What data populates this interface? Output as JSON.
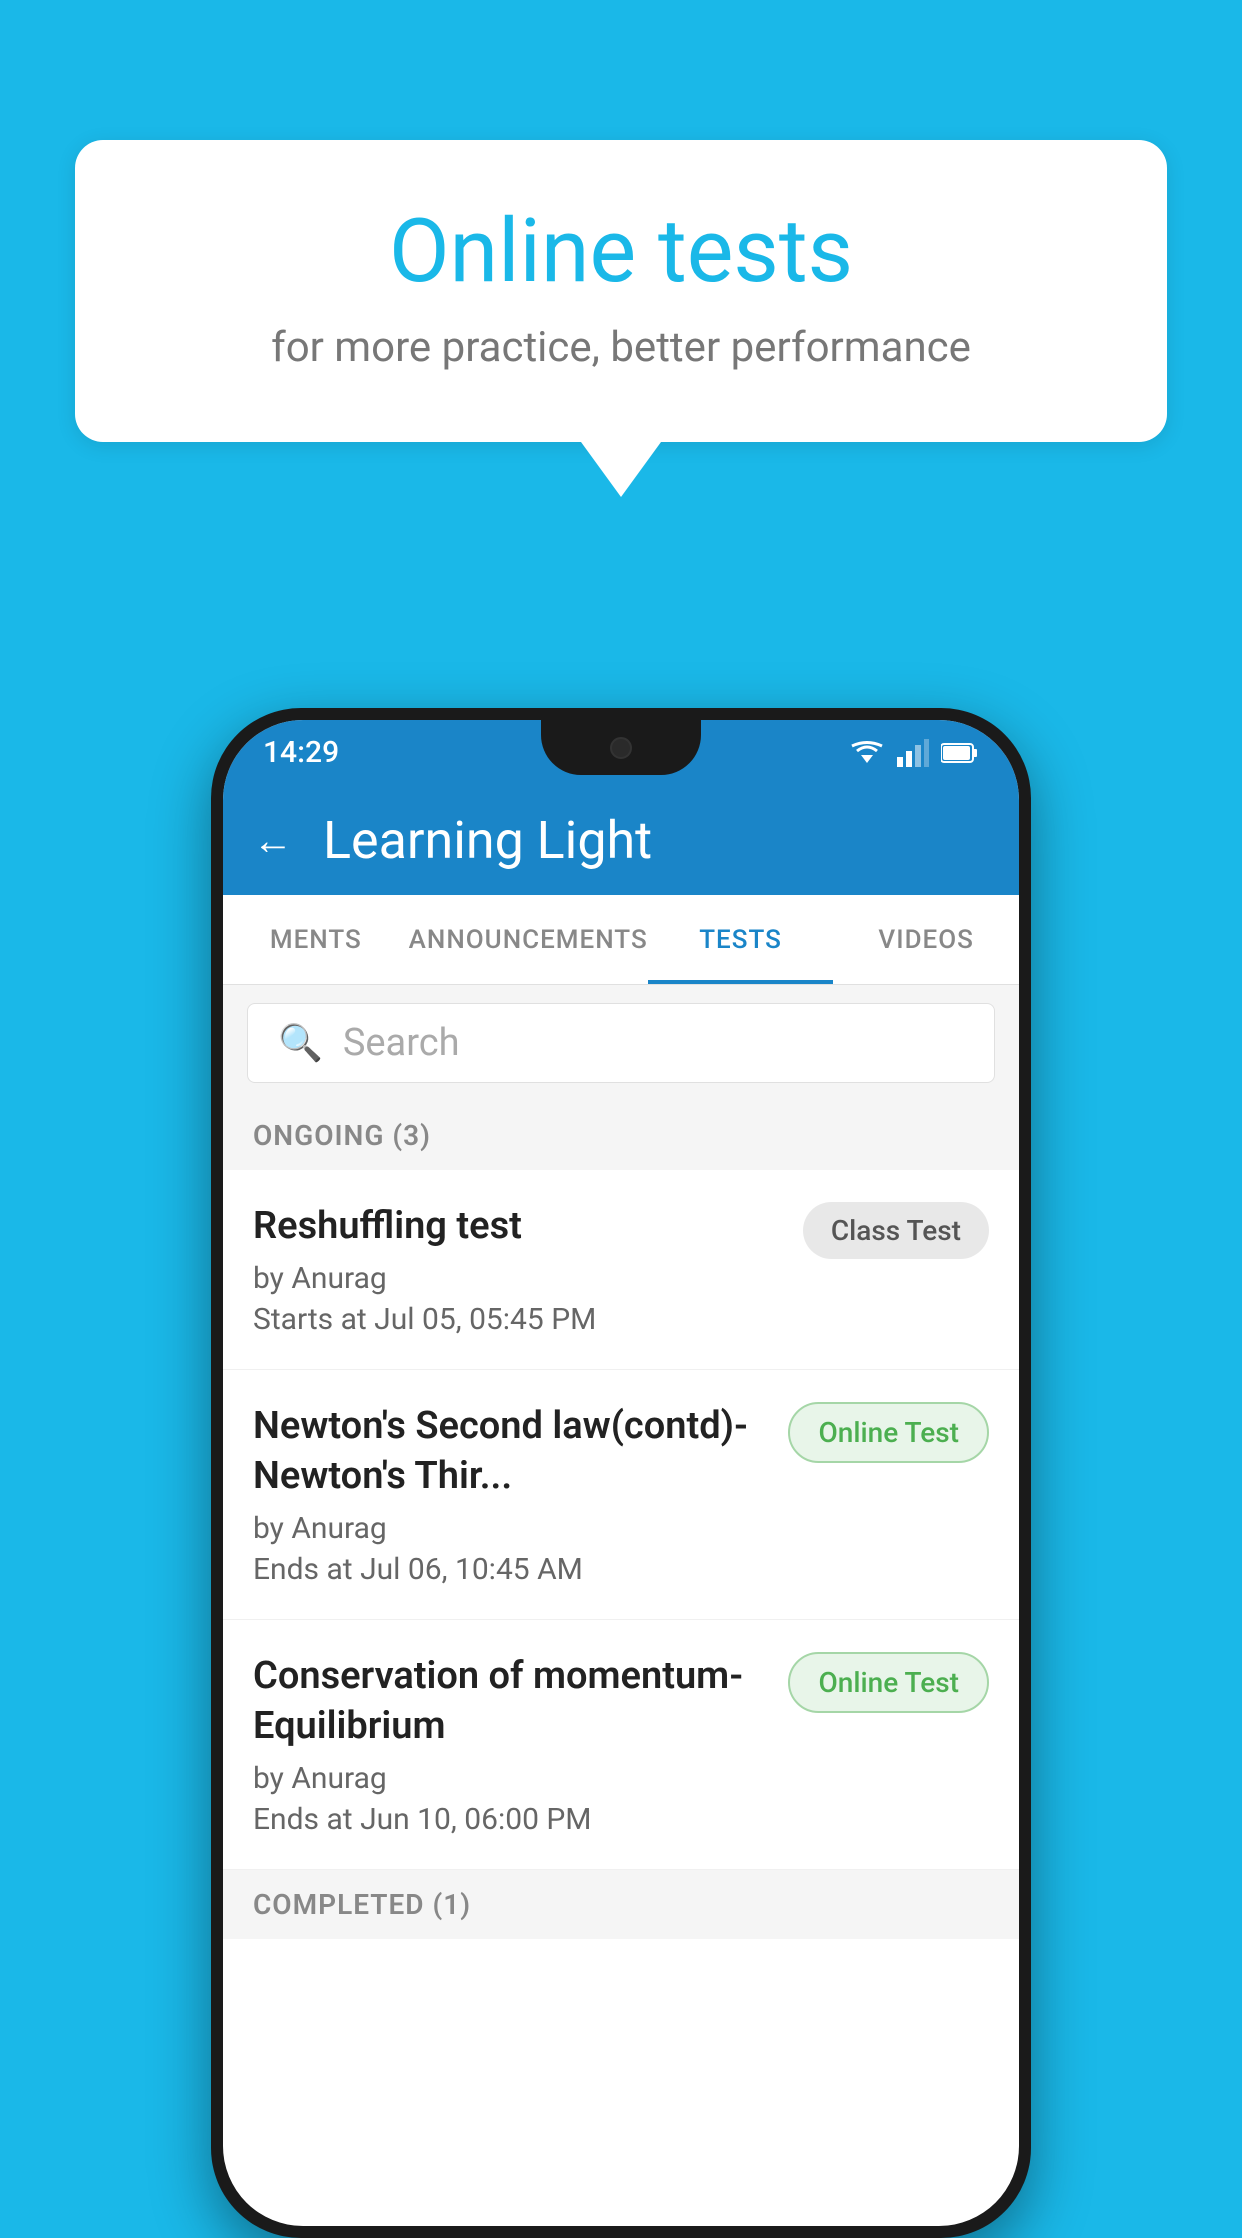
{
  "background": {
    "color": "#1ab8e8"
  },
  "speechBubble": {
    "title": "Online tests",
    "subtitle": "for more practice, better performance"
  },
  "phone": {
    "statusBar": {
      "time": "14:29",
      "icons": [
        "wifi",
        "signal",
        "battery"
      ]
    },
    "appBar": {
      "backLabel": "←",
      "title": "Learning Light"
    },
    "tabs": [
      {
        "label": "MENTS",
        "active": false
      },
      {
        "label": "ANNOUNCEMENTS",
        "active": false
      },
      {
        "label": "TESTS",
        "active": true
      },
      {
        "label": "VIDEOS",
        "active": false
      }
    ],
    "search": {
      "placeholder": "Search"
    },
    "ongoingSection": {
      "label": "ONGOING (3)"
    },
    "testItems": [
      {
        "title": "Reshuffling test",
        "author": "by Anurag",
        "timeLabel": "Starts at",
        "time": "Jul 05, 05:45 PM",
        "badge": "Class Test",
        "badgeType": "class"
      },
      {
        "title": "Newton's Second law(contd)-Newton's Thir...",
        "author": "by Anurag",
        "timeLabel": "Ends at",
        "time": "Jul 06, 10:45 AM",
        "badge": "Online Test",
        "badgeType": "online"
      },
      {
        "title": "Conservation of momentum-Equilibrium",
        "author": "by Anurag",
        "timeLabel": "Ends at",
        "time": "Jun 10, 06:00 PM",
        "badge": "Online Test",
        "badgeType": "online"
      }
    ],
    "completedSection": {
      "label": "COMPLETED (1)"
    }
  }
}
